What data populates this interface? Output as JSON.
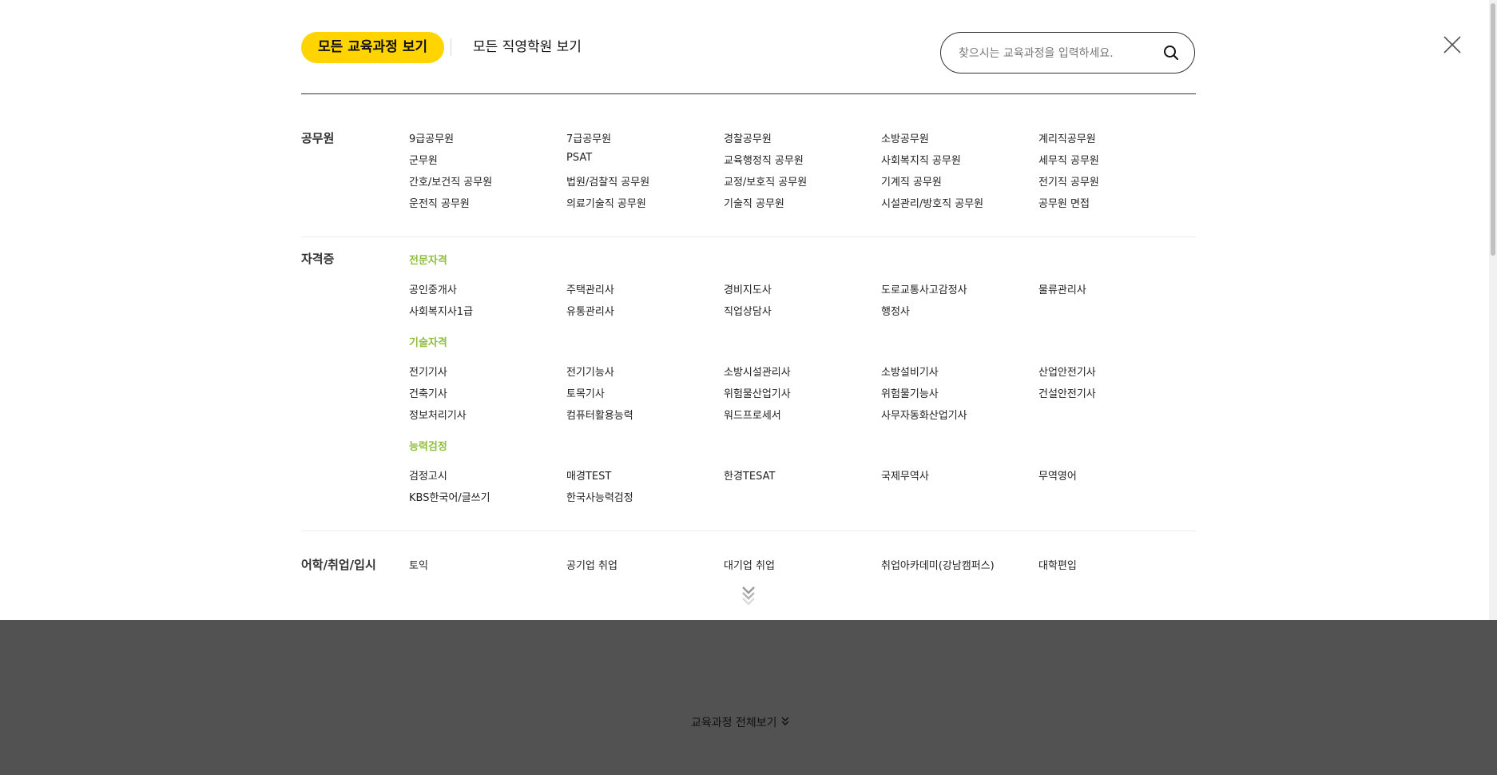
{
  "header": {
    "tab_active": "모든 교육과정 보기",
    "tab_other": "모든 직영학원 보기",
    "search_placeholder": "찾으시는 교육과정을 입력하세요.",
    "search_icon": "search-icon",
    "close_icon": "close-icon"
  },
  "categories": [
    {
      "title": "공무원",
      "groups": [
        {
          "subtitle": "",
          "items": [
            "9급공무원",
            "7급공무원",
            "경찰공무원",
            "소방공무원",
            "계리직공무원",
            "군무원",
            "PSAT",
            "교육행정직 공무원",
            "사회복지직 공무원",
            "세무직 공무원",
            "간호/보건직 공무원",
            "법원/검찰직 공무원",
            "교정/보호직 공무원",
            "기계직 공무원",
            "전기직 공무원",
            "운전직 공무원",
            "의료기술직 공무원",
            "기술직 공무원",
            "시설관리/방호직 공무원",
            "공무원 면접"
          ]
        }
      ]
    },
    {
      "title": "자격증",
      "groups": [
        {
          "subtitle": "전문자격",
          "items": [
            "공인중개사",
            "주택관리사",
            "경비지도사",
            "도로교통사고감정사",
            "물류관리사",
            "사회복지사1급",
            "유통관리사",
            "직업상담사",
            "행정사"
          ]
        },
        {
          "subtitle": "기술자격",
          "items": [
            "전기기사",
            "전기기능사",
            "소방시설관리사",
            "소방설비기사",
            "산업안전기사",
            "건축기사",
            "토목기사",
            "위험물산업기사",
            "위험물기능사",
            "건설안전기사",
            "정보처리기사",
            "컴퓨터활용능력",
            "워드프로세서",
            "사무자동화산업기사"
          ]
        },
        {
          "subtitle": "능력검정",
          "items": [
            "검정고시",
            "매경TEST",
            "한경TESAT",
            "국제무역사",
            "무역영어",
            "KBS한국어/글쓰기",
            "한국사능력검정"
          ]
        }
      ]
    },
    {
      "title": "어학/취업/입시",
      "groups": [
        {
          "subtitle": "",
          "items": [
            "토익",
            "공기업 취업",
            "대기업 취업",
            "취업아카데미(강남캠퍼스)",
            "대학편입"
          ]
        }
      ]
    }
  ],
  "more_icon": "double-chevron-down-icon",
  "footer": {
    "link_label": "교육과정 전체보기",
    "link_icon": "double-chevron-down-icon"
  },
  "colors": {
    "accent": "#ffd400",
    "subtitle": "#8fbf3b",
    "footer_bg": "#525252"
  }
}
